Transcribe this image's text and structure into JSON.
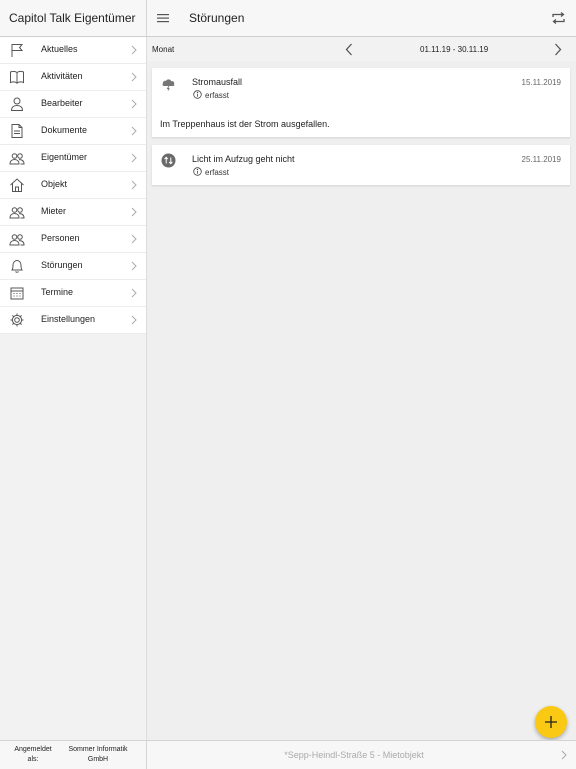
{
  "header": {
    "app_title": "Capitol Talk Eigentümer",
    "page_title": "Störungen",
    "menu_icon": "hamburger-menu-icon",
    "sync_icon": "sync-icon"
  },
  "sidebar": {
    "items": [
      {
        "label": "Aktuelles",
        "icon": "flag-icon"
      },
      {
        "label": "Aktivitäten",
        "icon": "book-icon"
      },
      {
        "label": "Bearbeiter",
        "icon": "person-icon"
      },
      {
        "label": "Dokumente",
        "icon": "document-icon"
      },
      {
        "label": "Eigentümer",
        "icon": "people-icon"
      },
      {
        "label": "Objekt",
        "icon": "house-icon"
      },
      {
        "label": "Mieter",
        "icon": "people-icon"
      },
      {
        "label": "Personen",
        "icon": "people-icon"
      },
      {
        "label": "Störungen",
        "icon": "bell-icon"
      },
      {
        "label": "Termine",
        "icon": "calendar-icon"
      },
      {
        "label": "Einstellungen",
        "icon": "gear-icon"
      }
    ]
  },
  "subbar": {
    "period_label": "Monat",
    "range": "01.11.19 - 30.11.19"
  },
  "disturbances": [
    {
      "title": "Stromausfall",
      "date": "15.11.2019",
      "status": "erfasst",
      "description": "Im Treppenhaus ist der Strom ausgefallen.",
      "icon": "power-outage-cloud-icon"
    },
    {
      "title": "Licht im Aufzug geht nicht",
      "date": "25.11.2019",
      "status": "erfasst",
      "icon": "elevator-icon"
    }
  ],
  "footer": {
    "logged_in_label": "Angemeldet als:",
    "company": "Sommer Informatik GmbH",
    "object": "*Sepp-Heindl-Straße 5 - Mietobjekt"
  },
  "colors": {
    "accent_fab": "#f9c914",
    "background": "#efefef"
  }
}
